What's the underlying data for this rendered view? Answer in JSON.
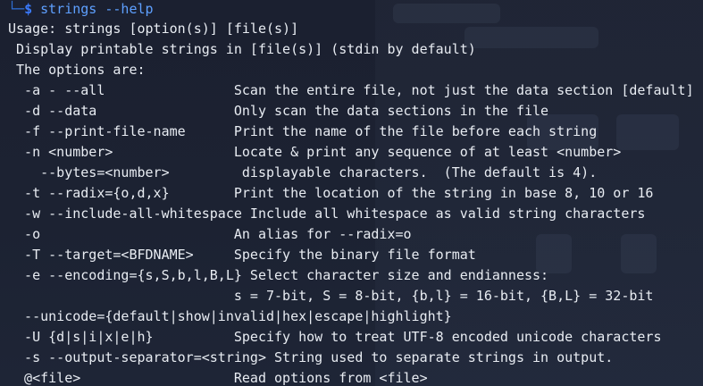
{
  "prompt": {
    "corner": "└─",
    "symbol": "$",
    "command": " strings --help"
  },
  "help_lines": [
    "Usage: strings [option(s)] [file(s)]",
    " Display printable strings in [file(s)] (stdin by default)",
    " The options are:",
    "  -a - --all                Scan the entire file, not just the data section [default]",
    "  -d --data                 Only scan the data sections in the file",
    "  -f --print-file-name      Print the name of the file before each string",
    "  -n <number>               Locate & print any sequence of at least <number>",
    "    --bytes=<number>         displayable characters.  (The default is 4).",
    "  -t --radix={o,d,x}        Print the location of the string in base 8, 10 or 16",
    "  -w --include-all-whitespace Include all whitespace as valid string characters",
    "  -o                        An alias for --radix=o",
    "  -T --target=<BFDNAME>     Specify the binary file format",
    "  -e --encoding={s,S,b,l,B,L} Select character size and endianness:",
    "                            s = 7-bit, S = 8-bit, {b,l} = 16-bit, {B,L} = 32-bit",
    "  --unicode={default|show|invalid|hex|escape|highlight}",
    "  -U {d|s|i|x|e|h}          Specify how to treat UTF-8 encoded unicode characters",
    "  -s --output-separator=<string> String used to separate strings in output.",
    "  @<file>                   Read options from <file>"
  ],
  "colors": {
    "background": "#1c2232",
    "text": "#e8ecf2",
    "prompt": "#3b7bff"
  }
}
